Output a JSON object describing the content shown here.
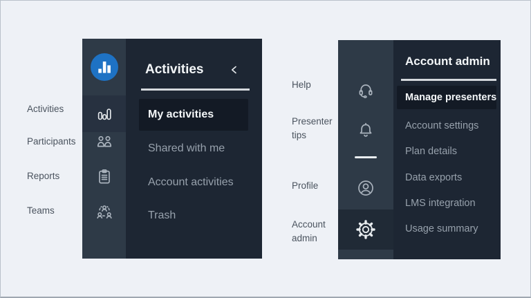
{
  "left_sidebar": {
    "annotations": [
      "Activities",
      "Participants",
      "Reports",
      "Teams"
    ],
    "header": {
      "title": "Activities"
    },
    "rail": {
      "logo_icon": "bar-chart-logo",
      "items": [
        {
          "icon": "bar-chart-icon",
          "label": "Activities",
          "selected": true
        },
        {
          "icon": "participants-icon",
          "label": "Participants",
          "selected": false
        },
        {
          "icon": "clipboard-icon",
          "label": "Reports",
          "selected": false
        },
        {
          "icon": "teams-icon",
          "label": "Teams",
          "selected": false
        }
      ]
    },
    "menu": [
      {
        "label": "My activities",
        "selected": true
      },
      {
        "label": "Shared with me",
        "selected": false
      },
      {
        "label": "Account activities",
        "selected": false
      },
      {
        "label": "Trash",
        "selected": false
      }
    ]
  },
  "right_sidebar": {
    "annotations": [
      "Help",
      "Presenter tips",
      "Profile",
      "Account admin"
    ],
    "header": {
      "title": "Account admin"
    },
    "rail": {
      "icons": [
        "headset-icon",
        "bell-icon",
        "profile-icon",
        "gear-icon"
      ],
      "selected_icon": "gear-icon"
    },
    "menu": [
      {
        "label": "Manage presenters",
        "selected": true
      },
      {
        "label": "Account settings",
        "selected": false
      },
      {
        "label": "Plan details",
        "selected": false
      },
      {
        "label": "Data exports",
        "selected": false
      },
      {
        "label": "LMS integration",
        "selected": false
      },
      {
        "label": "Usage summary",
        "selected": false
      }
    ]
  },
  "colors": {
    "background": "#eef1f6",
    "border": "#b9c1ca",
    "rail": "#2e3a47",
    "rail_selected_left": "#273140",
    "rail_selected_right": "#202a36",
    "panel": "#1d2633",
    "item_highlight": "#131a25",
    "logo_blue": "#1e72c4",
    "text_primary": "#f3f6f8",
    "text_muted": "#97a1ac",
    "icon": "#aab3bd",
    "icon_bright": "#e8ecef",
    "divider_light": "#e9edf0",
    "annotation_text": "#4a535e"
  }
}
